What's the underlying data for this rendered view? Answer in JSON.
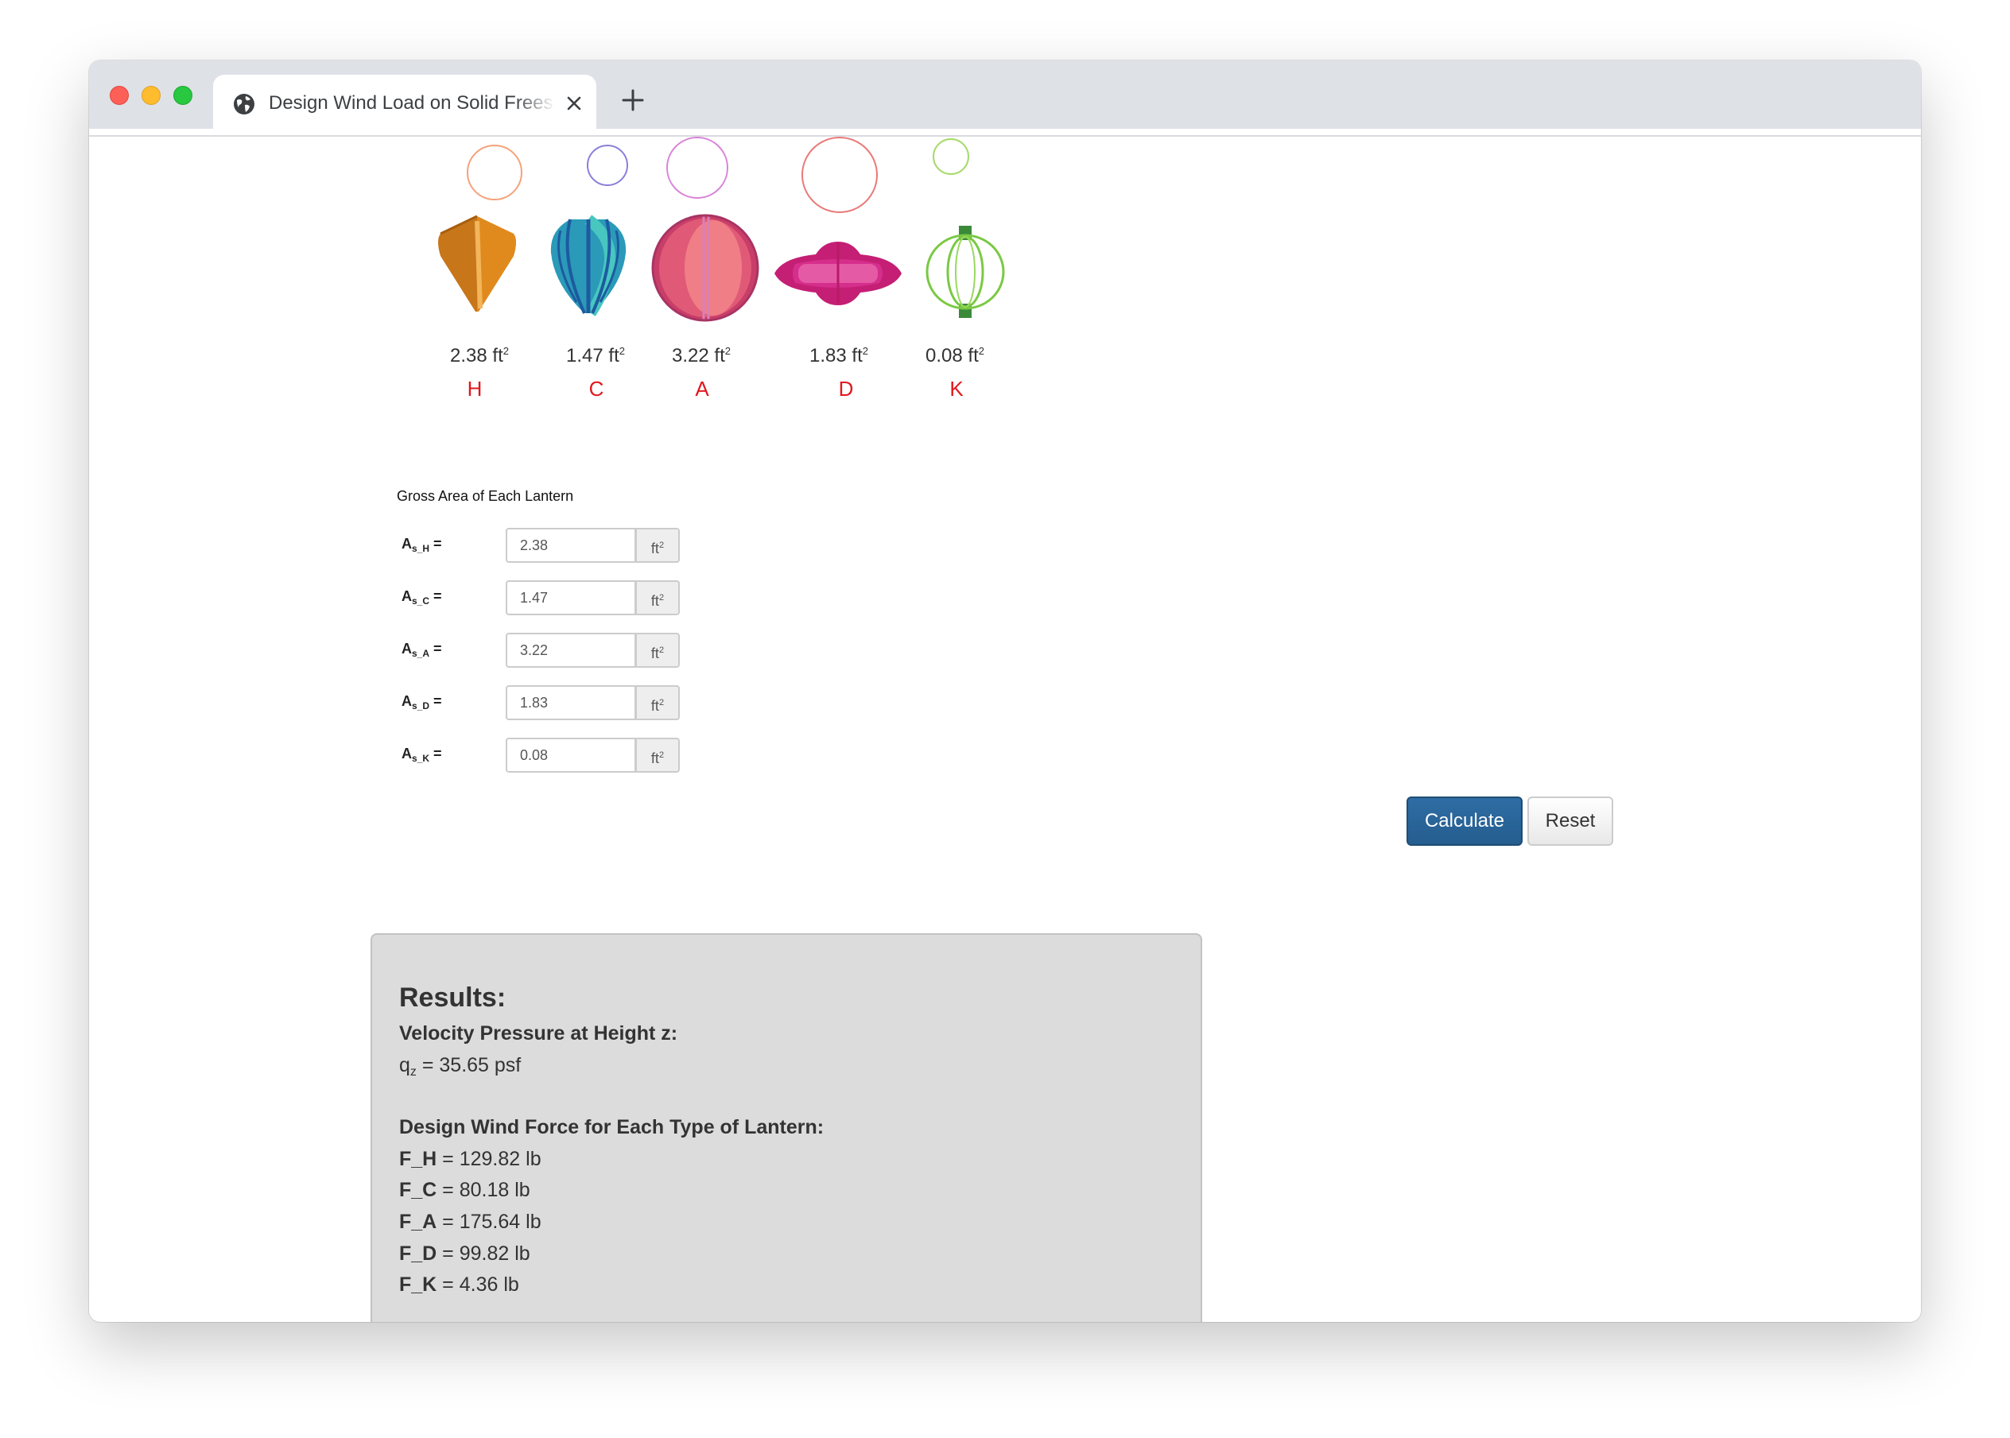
{
  "browser": {
    "tab_title": "Design Wind Load on Solid Freestanding Lanterns",
    "icons": {
      "tab": "globe-icon",
      "close": "close-icon",
      "new_tab": "plus-icon"
    }
  },
  "lanterns": [
    {
      "id": "H",
      "letter": "H",
      "area": "2.38 ft",
      "color": "#e08a1e"
    },
    {
      "id": "C",
      "letter": "C",
      "area": "1.47 ft",
      "color": "#2a9ab8"
    },
    {
      "id": "A",
      "letter": "A",
      "area": "3.22 ft",
      "color": "#e05a78"
    },
    {
      "id": "D",
      "letter": "D",
      "area": "1.83 ft",
      "color": "#d52e8c"
    },
    {
      "id": "K",
      "letter": "K",
      "area": "0.08 ft",
      "color": "#7ac943"
    }
  ],
  "area_unit_exponent": "2",
  "form": {
    "section_title": "Gross Area of Each Lantern",
    "unit": "ft",
    "unit_exponent": "2",
    "fields": [
      {
        "label": "A",
        "sub": "s_H",
        "eq": " =",
        "value": "2.38"
      },
      {
        "label": "A",
        "sub": "s_C",
        "eq": " =",
        "value": "1.47"
      },
      {
        "label": "A",
        "sub": "s_A",
        "eq": " =",
        "value": "3.22"
      },
      {
        "label": "A",
        "sub": "s_D",
        "eq": " =",
        "value": "1.83"
      },
      {
        "label": "A",
        "sub": "s_K",
        "eq": " =",
        "value": "0.08"
      }
    ]
  },
  "buttons": {
    "calculate": "Calculate",
    "reset": "Reset"
  },
  "results": {
    "heading": "Results:",
    "velocity_title": "Velocity Pressure at Height z:",
    "qz_label": "q",
    "qz_sub": "z",
    "qz_value": " = 35.65 psf",
    "force_title": "Design Wind Force for Each Type of Lantern:",
    "forces": [
      {
        "label": "F_H",
        "value": " = 129.82 lb"
      },
      {
        "label": "F_C",
        "value": " = 80.18 lb"
      },
      {
        "label": "F_A",
        "value": " = 175.64 lb"
      },
      {
        "label": "F_D",
        "value": " = 99.82 lb"
      },
      {
        "label": "F_K",
        "value": " = 4.36 lb"
      }
    ]
  }
}
